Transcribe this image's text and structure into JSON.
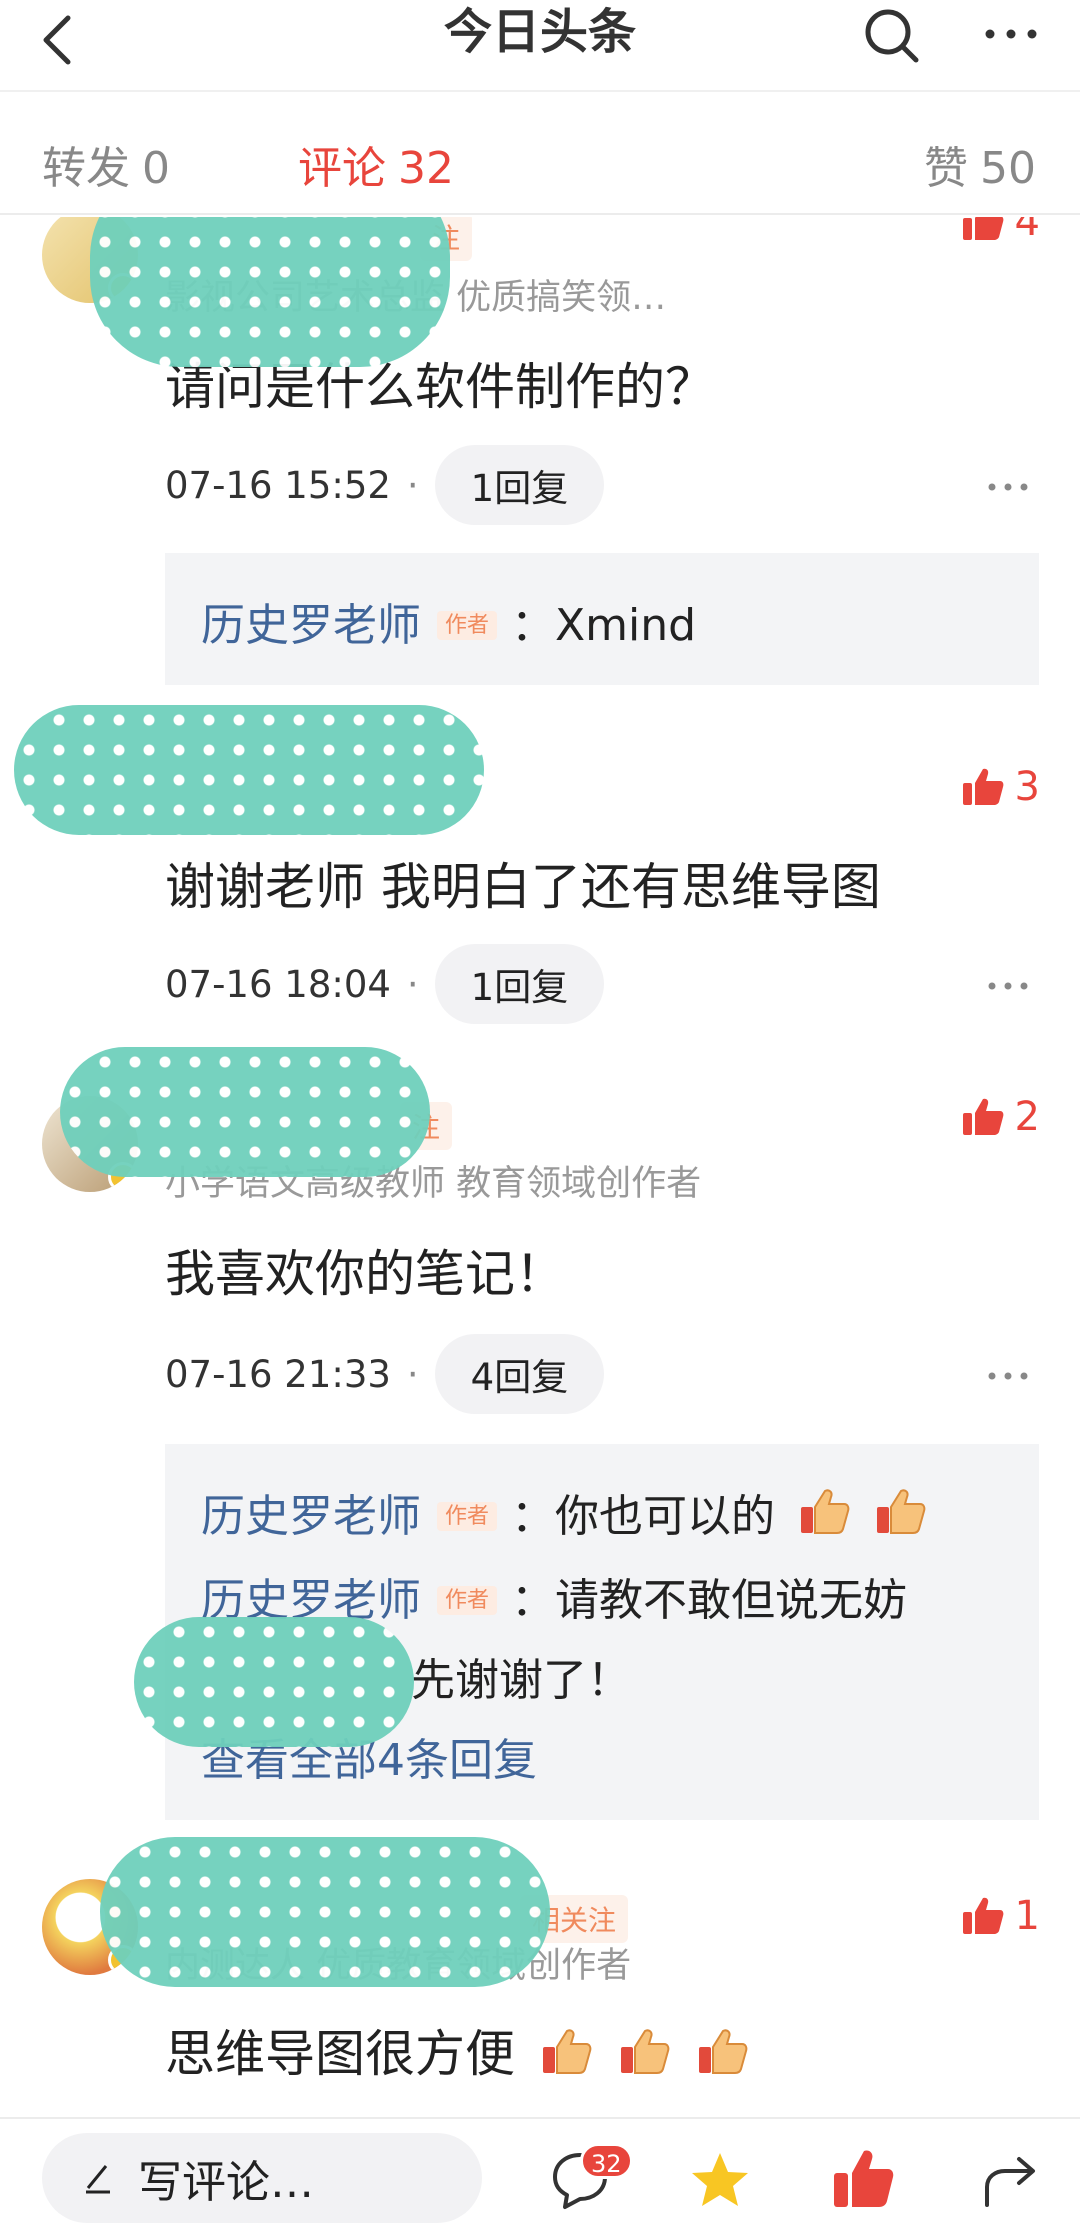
{
  "header": {
    "title": "今日头条",
    "icons": {
      "back": "back-arrow-icon",
      "search": "search-icon",
      "more": "more-icon"
    }
  },
  "tabs": {
    "forward": {
      "label": "转发",
      "count": "0"
    },
    "comments": {
      "label": "评论",
      "count": "32"
    },
    "likes": {
      "label": "赞",
      "count": "50"
    }
  },
  "comments": [
    {
      "name_suffix": "注",
      "desc": "影视公司艺术总监 优质搞笑领…",
      "likes": "4",
      "text": "请问是什么软件制作的？",
      "time": "07-16 15:52",
      "reply_count": "1回复",
      "replies": [
        {
          "name": "历史罗老师",
          "tag": "作者",
          "text": "：Xmind"
        }
      ]
    },
    {
      "likes": "3",
      "text": "谢谢老师 我明白了还有思维导图",
      "time": "07-16 18:04",
      "reply_count": "1回复"
    },
    {
      "name_suffix": "注",
      "desc": "小学语文高级教师 教育领域创作者",
      "likes": "2",
      "text": "我喜欢你的笔记！",
      "time": "07-16 21:33",
      "reply_count": "4回复",
      "replies": [
        {
          "name": "历史罗老师",
          "tag": "作者",
          "text": "：你也可以的"
        },
        {
          "name": "历史罗老师",
          "tag": "作者",
          "text": "：请教不敢但说无妨"
        }
      ],
      "reply_tail": "先谢谢了！",
      "view_all": "查看全部4条回复"
    },
    {
      "name_suffix": "相关注",
      "desc": "内测达人 优质教育领域创作者",
      "likes": "1",
      "text": "思维导图很方便"
    }
  ],
  "bottom": {
    "placeholder": "写评论…",
    "comment_badge": "32",
    "icons": [
      "pen-icon",
      "comment-icon",
      "star-icon",
      "thumbs-up-icon",
      "share-icon"
    ]
  },
  "colors": {
    "accent": "#e8453c",
    "name_blue": "#406599",
    "muted": "#999999",
    "reply_bg": "#f3f4f6"
  }
}
